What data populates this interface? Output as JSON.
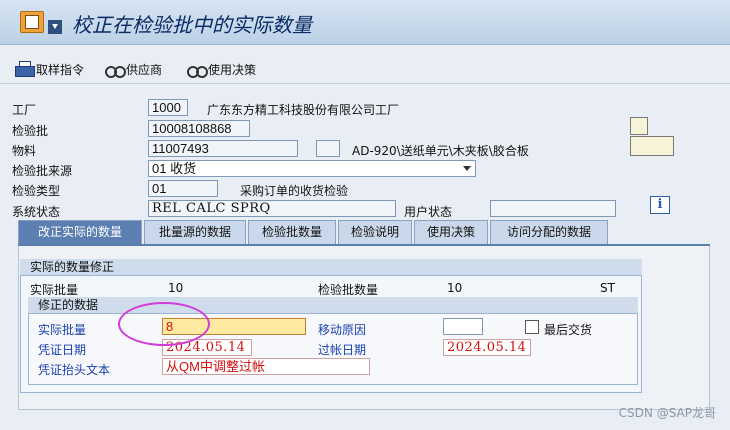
{
  "title": "校正在检验批中的实际数量",
  "toolbar": {
    "sample_instruction": "取样指令",
    "vendor": "供应商",
    "usage_decision": "使用决策"
  },
  "header": {
    "plant_label": "工厂",
    "plant_code": "1000",
    "plant_name": "广东东方精工科技股份有限公司工厂",
    "inspection_lot_label": "检验批",
    "inspection_lot": "10008108868",
    "material_label": "物料",
    "material": "11007493",
    "material_desc": "AD-920\\送纸单元\\木夹板\\胶合板",
    "lot_origin_label": "检验批来源",
    "lot_origin": "01 收货",
    "inspection_type_label": "检验类型",
    "inspection_type": "01",
    "inspection_type_desc": "采购订单的收货检验",
    "system_status_label": "系统状态",
    "system_status": "REL  CALC SPRQ",
    "user_status_label": "用户状态",
    "user_status": ""
  },
  "tabs": [
    {
      "label": "改正实际的数量",
      "active": true
    },
    {
      "label": "批量源的数据",
      "active": false
    },
    {
      "label": "检验批数量",
      "active": false
    },
    {
      "label": "检验说明",
      "active": false
    },
    {
      "label": "使用决策",
      "active": false
    },
    {
      "label": "访问分配的数据",
      "active": false
    }
  ],
  "correction": {
    "group_title": "实际的数量修正",
    "actual_lot_label": "实际批量",
    "actual_lot_value": "10",
    "lot_qty_label": "检验批数量",
    "lot_qty_value": "10",
    "unit": "ST",
    "sub_title": "修正的数据",
    "actual_qty_label": "实际批量",
    "actual_qty_value": "8",
    "movement_reason_label": "移动原因",
    "movement_reason_value": "",
    "final_delivery_label": "最后交货",
    "doc_date_label": "凭证日期",
    "doc_date_value": "2024.05.14",
    "posting_date_label": "过帐日期",
    "posting_date_value": "2024.05.14",
    "header_text_label": "凭证抬头文本",
    "header_text_value": "从QM中调整过帐"
  },
  "watermark": "CSDN @SAP龙哥"
}
